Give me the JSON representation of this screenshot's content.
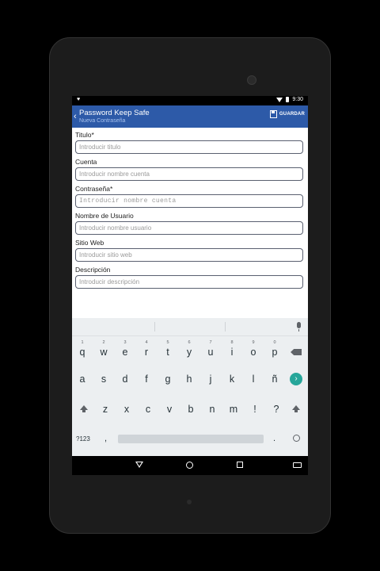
{
  "status_bar": {
    "time": "9:30"
  },
  "action_bar": {
    "title": "Password Keep Safe",
    "subtitle": "Nueva Contraseña",
    "save_label": "GUARDAR"
  },
  "form": {
    "fields": [
      {
        "label": "Titulo*",
        "placeholder": "Introducir titulo"
      },
      {
        "label": "Cuenta",
        "placeholder": "Introducir nombre cuenta"
      },
      {
        "label": "Contraseña*",
        "placeholder": "Introducir nombre cuenta"
      },
      {
        "label": "Nombre de Usuario",
        "placeholder": "Introducir nombre usuario"
      },
      {
        "label": "Sitio Web",
        "placeholder": "Introducir sitio web"
      },
      {
        "label": "Descripción",
        "placeholder": "Introducir descripción"
      }
    ]
  },
  "keyboard": {
    "row1": [
      {
        "key": "q",
        "hint": "1"
      },
      {
        "key": "w",
        "hint": "2"
      },
      {
        "key": "e",
        "hint": "3"
      },
      {
        "key": "r",
        "hint": "4"
      },
      {
        "key": "t",
        "hint": "5"
      },
      {
        "key": "y",
        "hint": "6"
      },
      {
        "key": "u",
        "hint": "7"
      },
      {
        "key": "i",
        "hint": "8"
      },
      {
        "key": "o",
        "hint": "9"
      },
      {
        "key": "p",
        "hint": "0"
      }
    ],
    "row2": [
      "a",
      "s",
      "d",
      "f",
      "g",
      "h",
      "j",
      "k",
      "l",
      "ñ"
    ],
    "row3": [
      "z",
      "x",
      "c",
      "v",
      "b",
      "n",
      "m",
      "!",
      "?"
    ],
    "symbols_label": "?123",
    "comma": ",",
    "period": "."
  }
}
